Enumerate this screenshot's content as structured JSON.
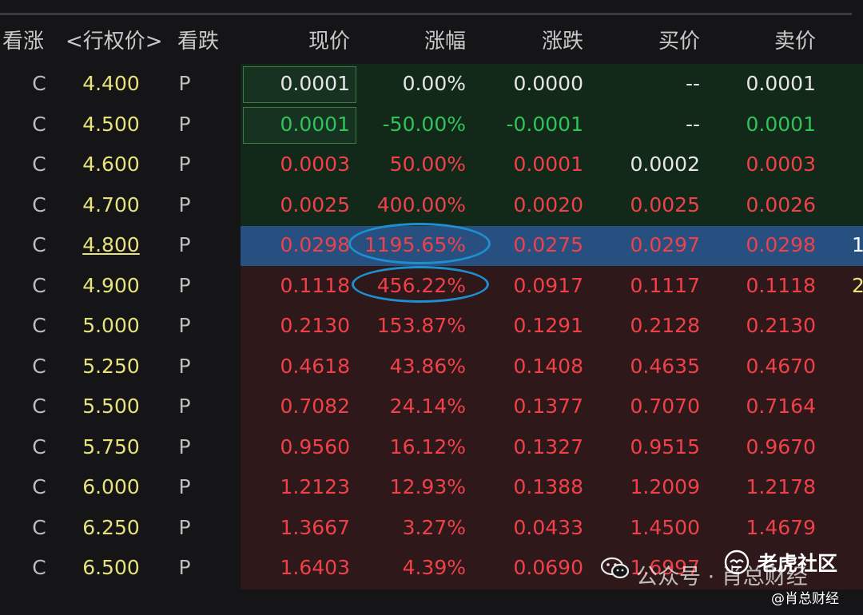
{
  "header": {
    "call": "看涨",
    "strike": "<行权价>",
    "put": "看跌",
    "price": "现价",
    "pct": "涨幅",
    "chg": "涨跌",
    "bid": "买价",
    "ask": "卖价"
  },
  "colors": {
    "up": "#f0414a",
    "down": "#2ec45a",
    "neutral": "#e6e6e6",
    "strike": "#e8e27a",
    "highlight": "#274f80",
    "annotation": "#1f8fd0"
  },
  "rows": [
    {
      "call": "C",
      "strike": "4.400",
      "put": "P",
      "price": "0.0001",
      "pct": "0.00%",
      "chg": "0.0000",
      "bid": "--",
      "ask": "0.0001",
      "extra": "",
      "price_color": "neutral",
      "pct_color": "neutral",
      "chg_color": "neutral",
      "bid_color": "neutral",
      "ask_color": "neutral"
    },
    {
      "call": "C",
      "strike": "4.500",
      "put": "P",
      "price": "0.0001",
      "pct": "-50.00%",
      "chg": "-0.0001",
      "bid": "--",
      "ask": "0.0001",
      "extra": "",
      "price_color": "down",
      "pct_color": "down",
      "chg_color": "down",
      "bid_color": "neutral",
      "ask_color": "down"
    },
    {
      "call": "C",
      "strike": "4.600",
      "put": "P",
      "price": "0.0003",
      "pct": "50.00%",
      "chg": "0.0001",
      "bid": "0.0002",
      "ask": "0.0003",
      "extra": "",
      "price_color": "up",
      "pct_color": "up",
      "chg_color": "up",
      "bid_color": "neutral",
      "ask_color": "up"
    },
    {
      "call": "C",
      "strike": "4.700",
      "put": "P",
      "price": "0.0025",
      "pct": "400.00%",
      "chg": "0.0020",
      "bid": "0.0025",
      "ask": "0.0026",
      "extra": "",
      "price_color": "up",
      "pct_color": "up",
      "chg_color": "up",
      "bid_color": "up",
      "ask_color": "up"
    },
    {
      "call": "C",
      "strike": "4.800",
      "put": "P",
      "price": "0.0298",
      "pct": "1195.65%",
      "chg": "0.0275",
      "bid": "0.0297",
      "ask": "0.0298",
      "extra": "1",
      "price_color": "up",
      "pct_color": "up",
      "chg_color": "up",
      "bid_color": "up",
      "ask_color": "up"
    },
    {
      "call": "C",
      "strike": "4.900",
      "put": "P",
      "price": "0.1118",
      "pct": "456.22%",
      "chg": "0.0917",
      "bid": "0.1117",
      "ask": "0.1118",
      "extra": "2",
      "price_color": "up",
      "pct_color": "up",
      "chg_color": "up",
      "bid_color": "up",
      "ask_color": "up"
    },
    {
      "call": "C",
      "strike": "5.000",
      "put": "P",
      "price": "0.2130",
      "pct": "153.87%",
      "chg": "0.1291",
      "bid": "0.2128",
      "ask": "0.2130",
      "extra": "",
      "price_color": "up",
      "pct_color": "up",
      "chg_color": "up",
      "bid_color": "up",
      "ask_color": "up"
    },
    {
      "call": "C",
      "strike": "5.250",
      "put": "P",
      "price": "0.4618",
      "pct": "43.86%",
      "chg": "0.1408",
      "bid": "0.4635",
      "ask": "0.4670",
      "extra": "",
      "price_color": "up",
      "pct_color": "up",
      "chg_color": "up",
      "bid_color": "up",
      "ask_color": "up"
    },
    {
      "call": "C",
      "strike": "5.500",
      "put": "P",
      "price": "0.7082",
      "pct": "24.14%",
      "chg": "0.1377",
      "bid": "0.7070",
      "ask": "0.7164",
      "extra": "",
      "price_color": "up",
      "pct_color": "up",
      "chg_color": "up",
      "bid_color": "up",
      "ask_color": "up"
    },
    {
      "call": "C",
      "strike": "5.750",
      "put": "P",
      "price": "0.9560",
      "pct": "16.12%",
      "chg": "0.1327",
      "bid": "0.9515",
      "ask": "0.9670",
      "extra": "",
      "price_color": "up",
      "pct_color": "up",
      "chg_color": "up",
      "bid_color": "up",
      "ask_color": "up"
    },
    {
      "call": "C",
      "strike": "6.000",
      "put": "P",
      "price": "1.2123",
      "pct": "12.93%",
      "chg": "0.1388",
      "bid": "1.2009",
      "ask": "1.2178",
      "extra": "",
      "price_color": "up",
      "pct_color": "up",
      "chg_color": "up",
      "bid_color": "up",
      "ask_color": "up"
    },
    {
      "call": "C",
      "strike": "6.250",
      "put": "P",
      "price": "1.3667",
      "pct": "3.27%",
      "chg": "0.0433",
      "bid": "1.4500",
      "ask": "1.4679",
      "extra": "",
      "price_color": "up",
      "pct_color": "up",
      "chg_color": "up",
      "bid_color": "up",
      "ask_color": "up"
    },
    {
      "call": "C",
      "strike": "6.500",
      "put": "P",
      "price": "1.6403",
      "pct": "4.39%",
      "chg": "0.0690",
      "bid": "1.6997",
      "ask": "",
      "extra": "",
      "price_color": "up",
      "pct_color": "up",
      "chg_color": "up",
      "bid_color": "up",
      "ask_color": "up"
    }
  ],
  "watermark": {
    "brand": "公众号 · 肖总财经",
    "tiger": "老虎社区",
    "handle": "@肖总财经",
    "wechat_icon": "wechat-icon",
    "tiger_icon": "tiger-community-icon"
  }
}
